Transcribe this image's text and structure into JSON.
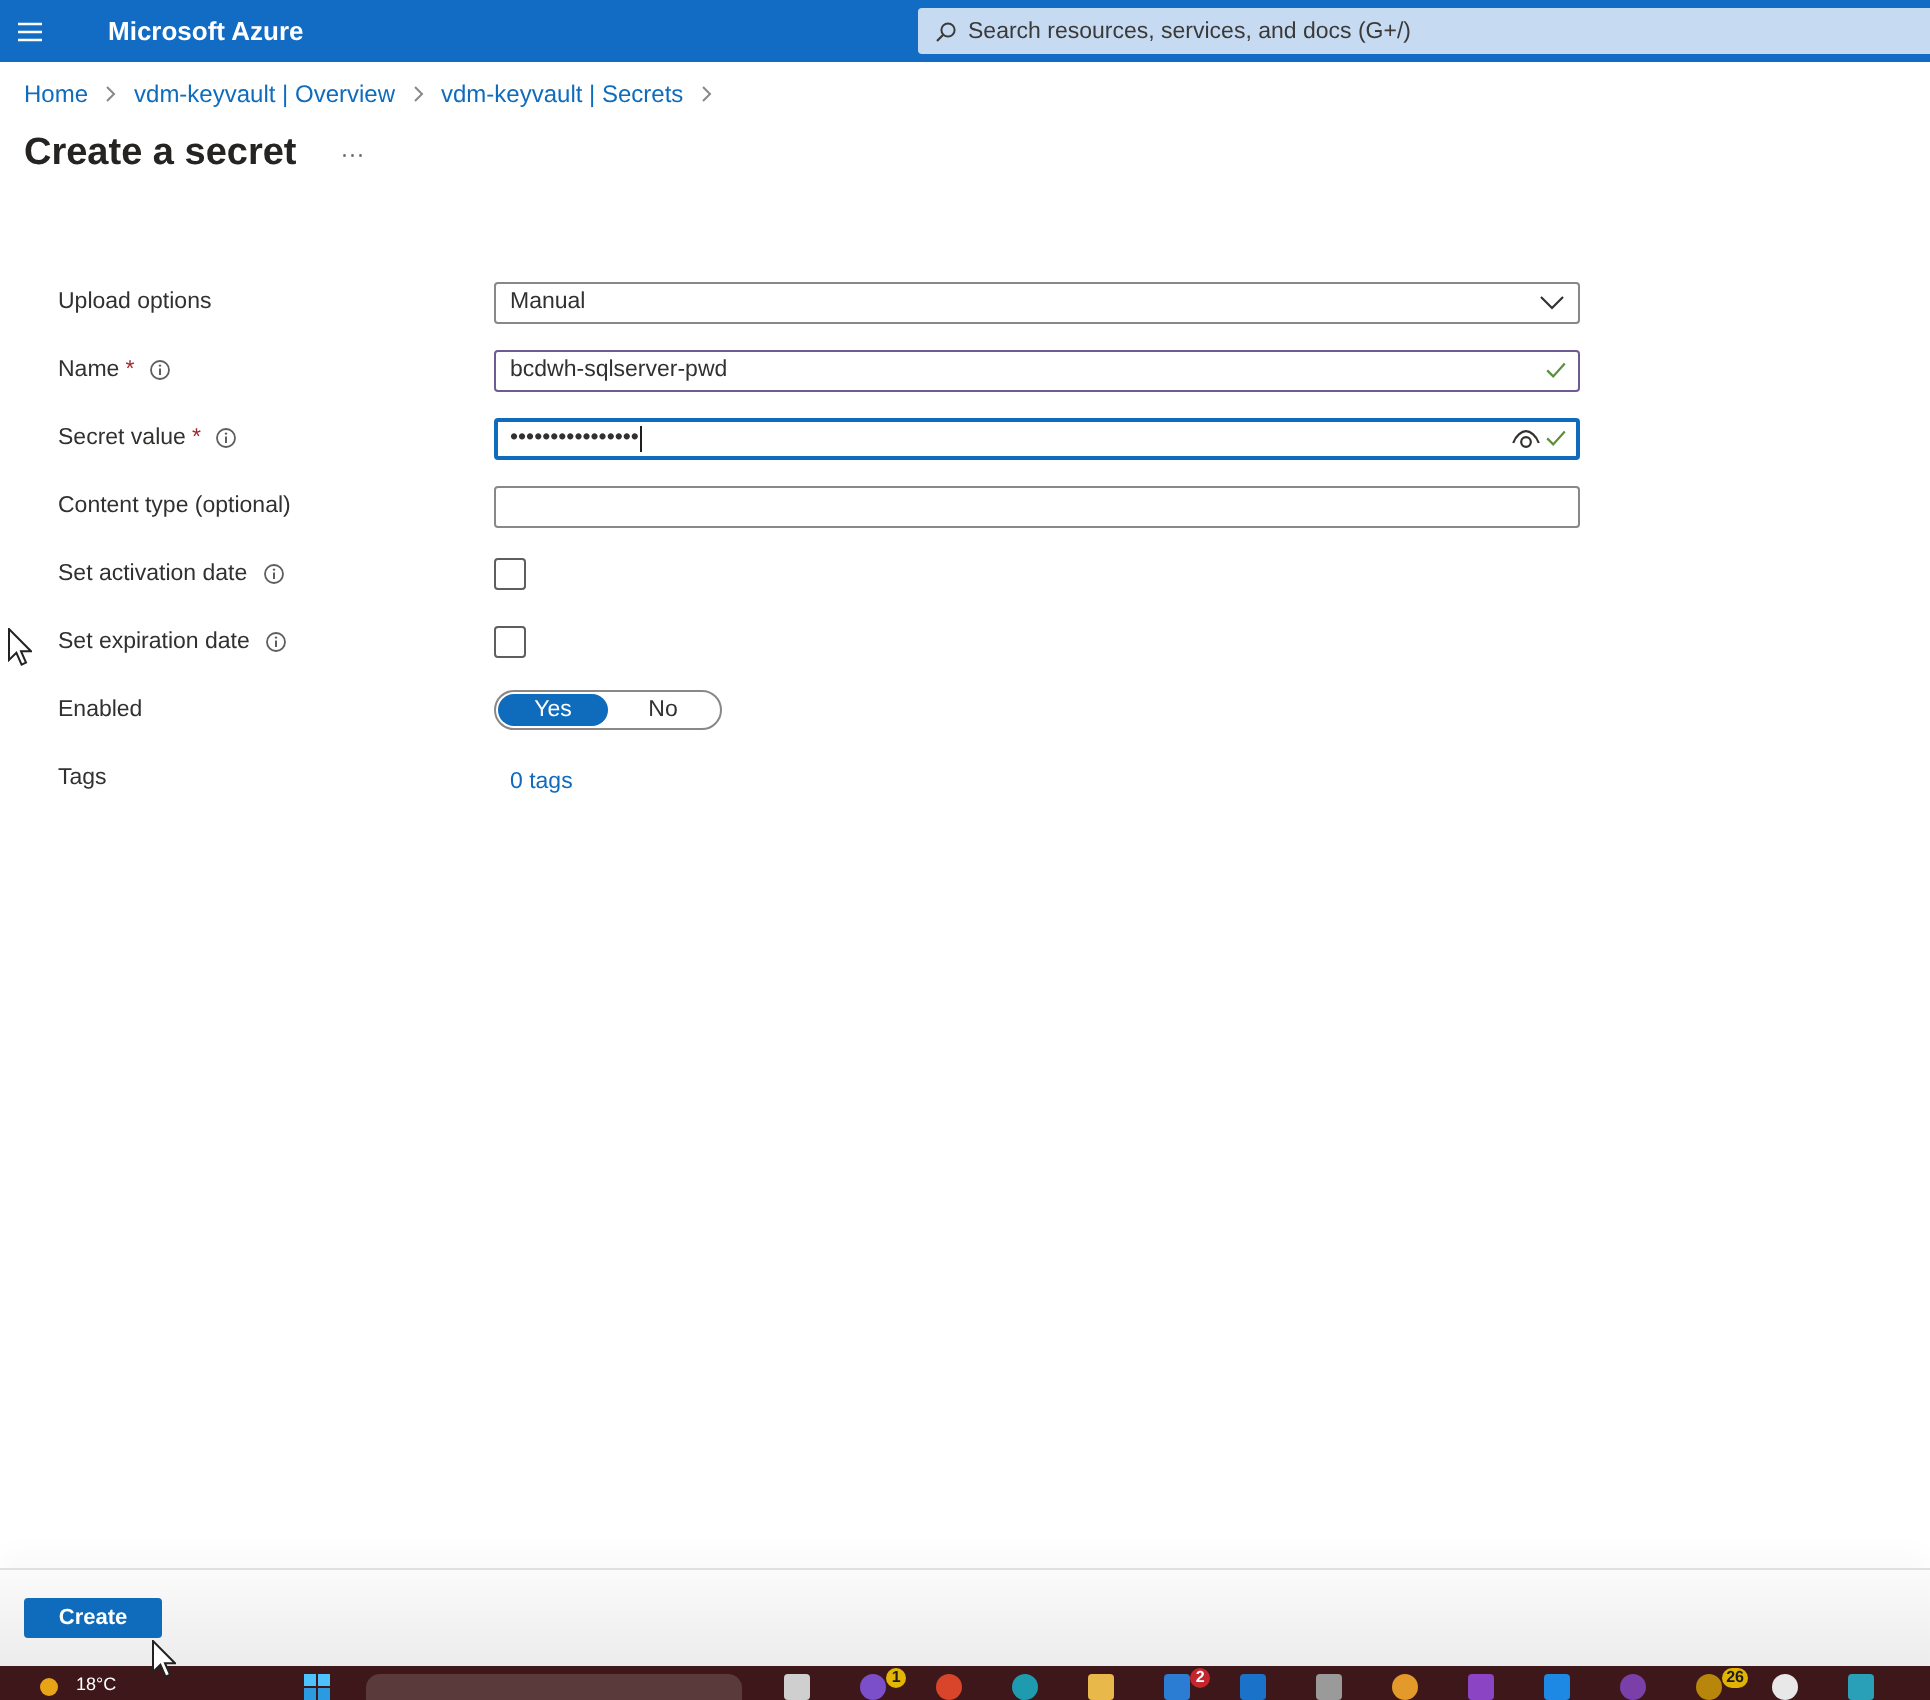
{
  "topbar": {
    "title": "Microsoft Azure",
    "search": {
      "placeholder": "Search resources, services, and docs (G+/)"
    }
  },
  "breadcrumb": [
    "Home",
    "vdm-keyvault | Overview",
    "vdm-keyvault | Secrets"
  ],
  "header": {
    "title": "Create a secret",
    "more": "···"
  },
  "form": {
    "fields": [
      {
        "kind": "dropdown",
        "label": "Upload options",
        "info": false,
        "value": "Manual"
      },
      {
        "kind": "text",
        "label": "Name",
        "required_mark": "*",
        "info": true,
        "value": "bcdwh-sqlserver-pwd",
        "valid": true,
        "hovered": true,
        "focused": false
      },
      {
        "kind": "password",
        "label": "Secret value",
        "required_mark": "*",
        "info": true,
        "value": "••••••••••••••••",
        "valid": true,
        "hovered": false,
        "focused": true
      },
      {
        "kind": "text",
        "label": "Content type (optional)",
        "info": false,
        "valid": false,
        "hovered": false,
        "focused": false
      },
      {
        "kind": "checkbox",
        "label": "Set activation date",
        "info": true,
        "checked": false
      },
      {
        "kind": "checkbox",
        "label": "Set expiration date",
        "info": true,
        "checked": false
      },
      {
        "kind": "toggle",
        "label": "Enabled",
        "info": false,
        "options": [
          {
            "label": "Yes",
            "selected": true
          },
          {
            "label": "No",
            "selected": false
          }
        ]
      },
      {
        "kind": "link",
        "label": "Tags",
        "info": false,
        "value": "0 tags"
      }
    ]
  },
  "footer": {
    "create_button": "Create"
  },
  "taskbar": {
    "weather": "18°C",
    "apps": [
      {
        "kind": "tile",
        "color": "#cfcfcf"
      },
      {
        "kind": "circle",
        "color": "#7b4fc9",
        "badge": {
          "text": "1",
          "color": "#e3b505"
        }
      },
      {
        "kind": "circle",
        "color": "#d9452b"
      },
      {
        "kind": "circle",
        "color": "#1f9bb0"
      },
      {
        "kind": "tile",
        "color": "#e8b84a"
      },
      {
        "kind": "tile",
        "color": "#2b7cd3",
        "badge": {
          "text": "2",
          "color": "#c4262e"
        }
      },
      {
        "kind": "tile",
        "color": "#1a73c9"
      },
      {
        "kind": "tile",
        "color": "#9a9a9a"
      },
      {
        "kind": "circle",
        "color": "#e39a2a"
      },
      {
        "kind": "tile",
        "color": "#8b44c4"
      },
      {
        "kind": "tile",
        "color": "#1e88e5"
      },
      {
        "kind": "circle",
        "color": "#7a3fa8"
      },
      {
        "kind": "circle",
        "color": "#b8860b",
        "badge": {
          "text": "26",
          "color": "#e0b400"
        }
      },
      {
        "kind": "circle",
        "color": "#e8e8e8"
      },
      {
        "kind": "tile",
        "color": "#2aa0b8"
      }
    ]
  }
}
